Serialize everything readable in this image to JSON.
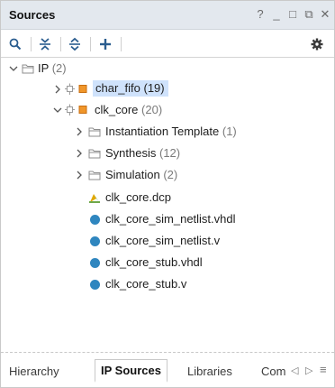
{
  "panel": {
    "title": "Sources",
    "controls": [
      "?",
      "_",
      "□",
      "⧉",
      "✕"
    ]
  },
  "toolbar": {
    "search_icon": "search-icon",
    "collapse_icon": "collapse-all-icon",
    "expand_icon": "expand-all-icon",
    "add_icon": "add-icon",
    "settings_icon": "gear-icon"
  },
  "tree": {
    "root": {
      "label": "IP",
      "count": "(2)"
    },
    "char_fifo": {
      "label": "char_fifo",
      "count": "(19)"
    },
    "clk_core": {
      "label": "clk_core",
      "count": "(20)"
    },
    "children": [
      {
        "label": "Instantiation Template",
        "count": "(1)"
      },
      {
        "label": "Synthesis",
        "count": "(12)"
      },
      {
        "label": "Simulation",
        "count": "(2)"
      }
    ],
    "files": [
      "clk_core.dcp",
      "clk_core_sim_netlist.vhdl",
      "clk_core_sim_netlist.v",
      "clk_core_stub.vhdl",
      "clk_core_stub.v"
    ]
  },
  "tabs": {
    "hierarchy": "Hierarchy",
    "ip_sources": "IP Sources",
    "libraries": "Libraries",
    "compile": "Com",
    "prev": "◁",
    "next": "▷",
    "menu": "≡"
  },
  "colors": {
    "accent_blue": "#2f86bf",
    "selection": "#cfe2fb",
    "ip_orange": "#f0962a"
  }
}
